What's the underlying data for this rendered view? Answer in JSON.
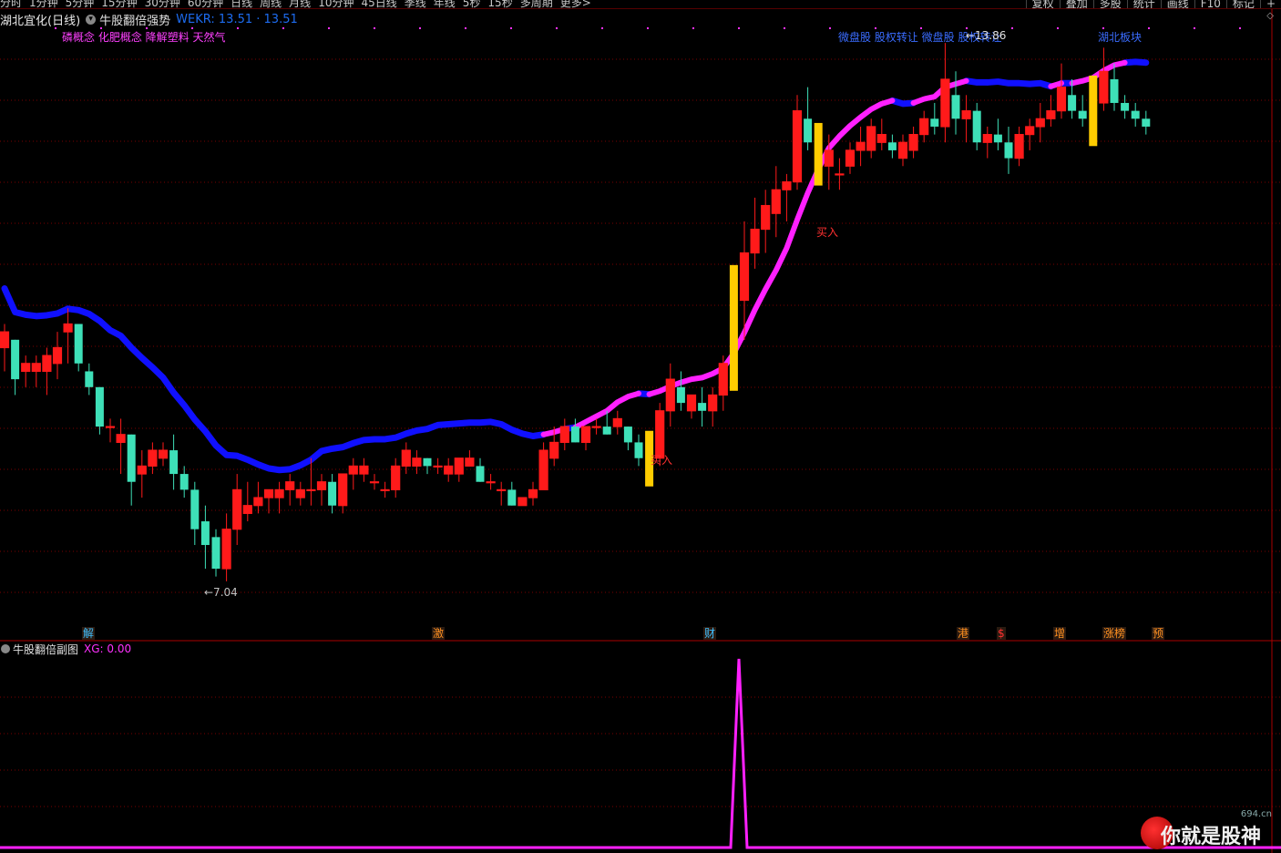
{
  "toolbar": {
    "periods": [
      "分时",
      "1分钟",
      "5分钟",
      "15分钟",
      "30分钟",
      "60分钟",
      "日线",
      "周线",
      "月线",
      "10分钟",
      "45日线",
      "季线",
      "年线",
      "5秒",
      "15秒",
      "多周期",
      "更多>"
    ],
    "right_buttons": [
      "复权",
      "叠加",
      "多股",
      "统计",
      "画线",
      "F10",
      "标记",
      "+"
    ]
  },
  "main": {
    "stock_title": "湖北宜化(日线)",
    "indicator_name": "牛股翻倍强势",
    "indicator_value": "WEKR: 13.51 · 13.51",
    "concepts_left": "磷概念 化肥概念 降解塑料 天然气",
    "concepts_right": "微盘股 股权转让 微盘股 股权转让",
    "sector_tag": "湖北板块",
    "low_label": "←7.04",
    "high_label": "←13.86",
    "buy_label_1": "买入",
    "buy_label_2": "买入"
  },
  "markers": [
    {
      "text": "解",
      "color": "#40c0ff"
    },
    {
      "text": "激",
      "color": "#ff9020"
    },
    {
      "text": "财",
      "color": "#40c0ff"
    },
    {
      "text": "港",
      "color": "#ff9020"
    },
    {
      "text": "$",
      "color": "#ff3030"
    },
    {
      "text": "增",
      "color": "#ff9020"
    },
    {
      "text": "涨榜",
      "color": "#ff9020"
    },
    {
      "text": "预",
      "color": "#ff9020"
    }
  ],
  "sub": {
    "title": "牛股翻倍副图",
    "xg": "XG: 0.00"
  },
  "watermark": {
    "site": "694.cn",
    "text": "你就是股神"
  },
  "colors": {
    "up": "#ff1a1a",
    "down": "#3ee0b8",
    "ma_line": "#1010ff",
    "strong_line": "#ff20ff",
    "highlight_bar": "#ffcc00",
    "grid": "#7a0000"
  },
  "chart_data": {
    "type": "candlestick",
    "price_range": [
      7.04,
      13.86
    ],
    "candles": [
      [
        10.0,
        10.3,
        9.7,
        10.2
      ],
      [
        10.1,
        10.1,
        9.4,
        9.6
      ],
      [
        9.7,
        9.9,
        9.5,
        9.8
      ],
      [
        9.7,
        9.9,
        9.5,
        9.8
      ],
      [
        9.7,
        10.0,
        9.4,
        9.9
      ],
      [
        9.8,
        10.2,
        9.6,
        10.0
      ],
      [
        10.2,
        10.5,
        9.8,
        10.3
      ],
      [
        10.3,
        10.3,
        9.7,
        9.8
      ],
      [
        9.7,
        9.8,
        9.4,
        9.5
      ],
      [
        9.5,
        9.5,
        8.9,
        9.0
      ],
      [
        9.0,
        9.1,
        8.8,
        9.0
      ],
      [
        8.8,
        9.1,
        8.4,
        8.9
      ],
      [
        8.9,
        8.9,
        8.0,
        8.3
      ],
      [
        8.4,
        8.7,
        8.1,
        8.5
      ],
      [
        8.5,
        8.8,
        8.4,
        8.7
      ],
      [
        8.6,
        8.8,
        8.5,
        8.7
      ],
      [
        8.7,
        8.9,
        8.2,
        8.4
      ],
      [
        8.4,
        8.5,
        8.1,
        8.2
      ],
      [
        8.2,
        8.3,
        7.5,
        7.7
      ],
      [
        7.8,
        8.0,
        7.2,
        7.5
      ],
      [
        7.6,
        7.7,
        7.1,
        7.2
      ],
      [
        7.2,
        7.9,
        7.04,
        7.7
      ],
      [
        7.7,
        8.4,
        7.5,
        8.2
      ],
      [
        7.9,
        8.3,
        7.8,
        8.0
      ],
      [
        8.0,
        8.3,
        7.9,
        8.1
      ],
      [
        8.1,
        8.2,
        7.9,
        8.2
      ],
      [
        8.1,
        8.3,
        7.9,
        8.2
      ],
      [
        8.2,
        8.4,
        8.0,
        8.3
      ],
      [
        8.1,
        8.3,
        8.0,
        8.2
      ],
      [
        8.2,
        8.6,
        8.0,
        8.2
      ],
      [
        8.2,
        8.4,
        8.0,
        8.3
      ],
      [
        8.3,
        8.4,
        7.9,
        8.0
      ],
      [
        8.0,
        8.4,
        7.9,
        8.4
      ],
      [
        8.4,
        8.6,
        8.2,
        8.5
      ],
      [
        8.4,
        8.6,
        8.3,
        8.5
      ],
      [
        8.3,
        8.4,
        8.2,
        8.3
      ],
      [
        8.2,
        8.3,
        8.1,
        8.2
      ],
      [
        8.2,
        8.6,
        8.1,
        8.5
      ],
      [
        8.5,
        8.8,
        8.4,
        8.7
      ],
      [
        8.5,
        8.7,
        8.4,
        8.6
      ],
      [
        8.6,
        8.6,
        8.4,
        8.5
      ],
      [
        8.5,
        8.6,
        8.4,
        8.5
      ],
      [
        8.4,
        8.6,
        8.3,
        8.5
      ],
      [
        8.4,
        8.6,
        8.3,
        8.6
      ],
      [
        8.5,
        8.7,
        8.5,
        8.6
      ],
      [
        8.5,
        8.6,
        8.3,
        8.3
      ],
      [
        8.3,
        8.4,
        8.2,
        8.3
      ],
      [
        8.2,
        8.3,
        8.0,
        8.2
      ],
      [
        8.2,
        8.3,
        8.0,
        8.0
      ],
      [
        8.0,
        8.1,
        8.0,
        8.1
      ],
      [
        8.1,
        8.3,
        8.0,
        8.2
      ],
      [
        8.2,
        8.8,
        8.2,
        8.7
      ],
      [
        8.6,
        9.0,
        8.5,
        8.8
      ],
      [
        8.8,
        9.1,
        8.7,
        9.0
      ],
      [
        9.0,
        9.1,
        8.8,
        8.8
      ],
      [
        8.8,
        9.0,
        8.7,
        9.0
      ],
      [
        9.0,
        9.1,
        8.9,
        9.0
      ],
      [
        9.0,
        9.2,
        8.9,
        8.9
      ],
      [
        9.0,
        9.2,
        8.9,
        9.1
      ],
      [
        9.0,
        9.0,
        8.7,
        8.8
      ],
      [
        8.8,
        8.9,
        8.5,
        8.6
      ],
      [
        8.6,
        8.7,
        8.5,
        8.6
      ],
      [
        8.6,
        9.3,
        8.5,
        9.2
      ],
      [
        9.2,
        9.8,
        9.0,
        9.6
      ],
      [
        9.5,
        9.7,
        9.2,
        9.3
      ],
      [
        9.2,
        9.4,
        9.1,
        9.4
      ],
      [
        9.3,
        9.5,
        9.0,
        9.2
      ],
      [
        9.2,
        9.5,
        9.0,
        9.4
      ],
      [
        9.4,
        9.9,
        9.2,
        9.8
      ],
      [
        9.8,
        10.9,
        9.6,
        10.7
      ],
      [
        10.6,
        11.6,
        10.1,
        11.2
      ],
      [
        11.2,
        11.9,
        11.0,
        11.5
      ],
      [
        11.5,
        12.0,
        11.2,
        11.8
      ],
      [
        11.7,
        12.3,
        11.4,
        12.0
      ],
      [
        12.0,
        12.2,
        11.6,
        12.1
      ],
      [
        12.1,
        13.2,
        12.0,
        13.0
      ],
      [
        12.9,
        13.3,
        12.5,
        12.6
      ],
      [
        12.5,
        12.7,
        12.3,
        12.4
      ],
      [
        12.3,
        12.7,
        12.0,
        12.5
      ],
      [
        12.2,
        12.4,
        12.0,
        12.2
      ],
      [
        12.3,
        12.6,
        12.2,
        12.5
      ],
      [
        12.5,
        12.8,
        12.3,
        12.6
      ],
      [
        12.5,
        12.9,
        12.4,
        12.8
      ],
      [
        12.6,
        12.9,
        12.5,
        12.7
      ],
      [
        12.6,
        12.7,
        12.4,
        12.5
      ],
      [
        12.4,
        12.7,
        12.3,
        12.6
      ],
      [
        12.5,
        12.8,
        12.4,
        12.7
      ],
      [
        12.7,
        13.0,
        12.6,
        12.9
      ],
      [
        12.9,
        13.1,
        12.7,
        12.8
      ],
      [
        12.8,
        13.86,
        12.6,
        13.4
      ],
      [
        13.2,
        13.5,
        12.7,
        12.9
      ],
      [
        12.9,
        13.2,
        12.6,
        13.0
      ],
      [
        13.0,
        13.1,
        12.5,
        12.6
      ],
      [
        12.6,
        12.8,
        12.4,
        12.7
      ],
      [
        12.7,
        12.9,
        12.5,
        12.6
      ],
      [
        12.6,
        12.8,
        12.2,
        12.4
      ],
      [
        12.4,
        12.8,
        12.3,
        12.7
      ],
      [
        12.7,
        12.9,
        12.5,
        12.8
      ],
      [
        12.8,
        13.1,
        12.6,
        12.9
      ],
      [
        12.9,
        13.2,
        12.8,
        13.0
      ],
      [
        13.0,
        13.6,
        12.9,
        13.3
      ],
      [
        13.2,
        13.4,
        12.9,
        13.0
      ],
      [
        13.0,
        13.2,
        12.8,
        12.9
      ],
      [
        12.9,
        13.3,
        12.7,
        13.1
      ],
      [
        13.1,
        13.8,
        13.0,
        13.5
      ],
      [
        13.4,
        13.6,
        13.0,
        13.1
      ],
      [
        13.1,
        13.2,
        12.9,
        13.0
      ],
      [
        13.0,
        13.1,
        12.8,
        12.9
      ],
      [
        12.9,
        13.0,
        12.7,
        12.8
      ]
    ],
    "buy_signal_index": 73
  }
}
